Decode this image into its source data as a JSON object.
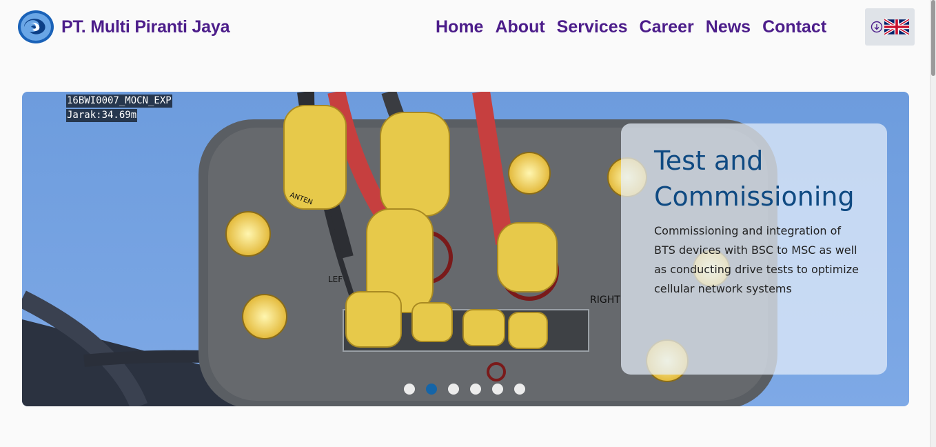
{
  "header": {
    "brand": "PT. Multi Piranti Jaya",
    "nav": [
      "Home",
      "About",
      "Services",
      "Career",
      "News",
      "Contact"
    ],
    "language_icon": "uk-flag-icon",
    "download_icon": "circle-arrow-down-icon"
  },
  "hero": {
    "photo_labels": [
      "16BWI0007_MOCN_EXP",
      "Jarak:34.69m"
    ],
    "title": "Test and Commissioning",
    "description": "Commissioning and integration of BTS devices with BSC to MSC as well as conducting drive tests to optimize cellular network systems",
    "photo_text": {
      "antenna": "ANTEN",
      "left": "LEF",
      "right": "RIGHT"
    },
    "slides_total": 6,
    "active_slide": 2
  },
  "colors": {
    "brand_purple": "#4c1d8a",
    "title_blue": "#0f4a82",
    "active_dot": "#1565a8",
    "sky": "#6f9fdf"
  }
}
